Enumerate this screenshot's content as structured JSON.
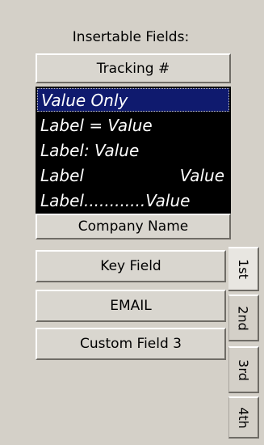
{
  "panel": {
    "title": "Insertable Fields:",
    "tracking_button": "Tracking #",
    "format_options": [
      {
        "left": "Value Only",
        "right": ""
      },
      {
        "left": "Label = Value",
        "right": ""
      },
      {
        "left": "Label: Value",
        "right": ""
      },
      {
        "left": "Label",
        "right": "Value"
      },
      {
        "left": "Label............Value",
        "right": ""
      }
    ],
    "selected_option": "Value Only",
    "company_button": "Company Name",
    "key_button": "Key Field",
    "email_button": "EMAIL",
    "custom_button": "Custom Field 3"
  },
  "tabs": [
    {
      "label": "1st",
      "active": true
    },
    {
      "label": "2nd",
      "active": false
    },
    {
      "label": "3rd",
      "active": false
    },
    {
      "label": "4th",
      "active": false
    }
  ]
}
